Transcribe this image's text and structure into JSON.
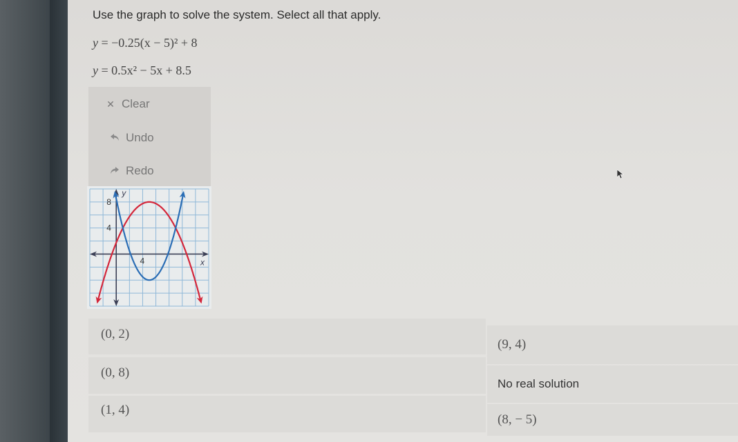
{
  "question": {
    "prompt": "Use the graph to solve the system. Select all that apply.",
    "equations": [
      {
        "lhs": "y",
        "rhs": "−0.25(x − 5)² + 8"
      },
      {
        "lhs": "y",
        "rhs": "0.5x² − 5x + 8.5"
      }
    ]
  },
  "tools": {
    "clear": {
      "icon": "close-icon",
      "label": "Clear"
    },
    "undo": {
      "icon": "undo-arrow-icon",
      "label": "Undo"
    },
    "redo": {
      "icon": "redo-arrow-icon",
      "label": "Redo"
    }
  },
  "graph": {
    "x_label": "x",
    "y_label": "y",
    "x_tick_label": "4",
    "y_tick_labels": [
      "4",
      "8"
    ],
    "colors": {
      "red_curve": "#d4263a",
      "blue_curve": "#2a6db5",
      "axes": "#3b3f55",
      "grid": "#8fb8d8"
    },
    "chart_data": {
      "type": "line",
      "xlim": [
        -4,
        14
      ],
      "ylim": [
        -8,
        10
      ],
      "grid_step": 2,
      "grid": true,
      "xlabel": "x",
      "ylabel": "y",
      "series": [
        {
          "name": "y = −0.25(x − 5)² + 8",
          "color": "red",
          "a": -0.25,
          "h": 5,
          "k": 8
        },
        {
          "name": "y = 0.5x² − 5x + 8.5",
          "color": "blue",
          "a": 0.5,
          "h": 5,
          "k": -4
        }
      ]
    }
  },
  "answers": [
    {
      "label": "(0, 2)",
      "selected": false
    },
    {
      "label": "(0, 8)",
      "selected": false
    },
    {
      "label": "(1, 4)",
      "selected": false
    },
    {
      "label": "(9, 4)",
      "selected": false
    },
    {
      "label": "No real solution",
      "selected": false
    },
    {
      "label": "(8, − 5)",
      "selected": false
    }
  ]
}
